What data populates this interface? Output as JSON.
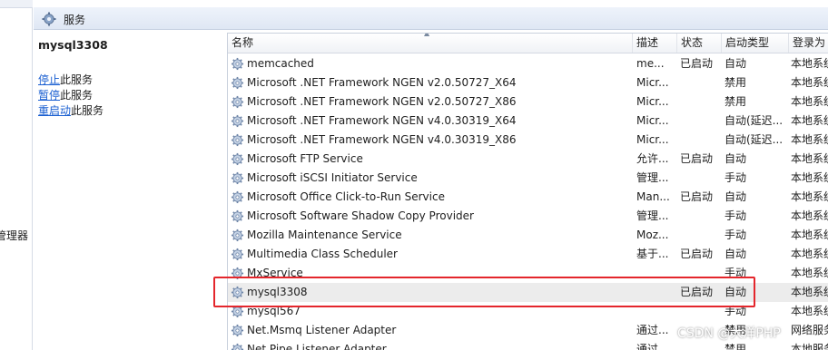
{
  "left_strip": {
    "label": "管理器"
  },
  "header": {
    "title": "服务",
    "icon": "gear-icon"
  },
  "description_pane": {
    "service_name": "mysql3308",
    "actions": [
      {
        "link": "停止",
        "suffix": "此服务"
      },
      {
        "link": "暂停",
        "suffix": "此服务"
      },
      {
        "link": "重启动",
        "suffix": "此服务"
      }
    ]
  },
  "columns": {
    "name": "名称",
    "desc": "描述",
    "status": "状态",
    "startup": "启动类型",
    "logon": "登录为"
  },
  "rows": [
    {
      "name": "memcached",
      "desc": "me...",
      "status": "已启动",
      "startup": "自动",
      "logon": "本地系统"
    },
    {
      "name": "Microsoft .NET Framework NGEN v2.0.50727_X64",
      "desc": "Micr...",
      "status": "",
      "startup": "禁用",
      "logon": "本地系统"
    },
    {
      "name": "Microsoft .NET Framework NGEN v2.0.50727_X86",
      "desc": "Micr...",
      "status": "",
      "startup": "禁用",
      "logon": "本地系统"
    },
    {
      "name": "Microsoft .NET Framework NGEN v4.0.30319_X64",
      "desc": "Micr...",
      "status": "",
      "startup": "自动(延迟...",
      "logon": "本地系统"
    },
    {
      "name": "Microsoft .NET Framework NGEN v4.0.30319_X86",
      "desc": "Micr...",
      "status": "",
      "startup": "自动(延迟...",
      "logon": "本地系统"
    },
    {
      "name": "Microsoft FTP Service",
      "desc": "允许...",
      "status": "已启动",
      "startup": "自动",
      "logon": "本地系统"
    },
    {
      "name": "Microsoft iSCSI Initiator Service",
      "desc": "管理...",
      "status": "",
      "startup": "手动",
      "logon": "本地系统"
    },
    {
      "name": "Microsoft Office Click-to-Run Service",
      "desc": "Man...",
      "status": "已启动",
      "startup": "自动",
      "logon": "本地系统"
    },
    {
      "name": "Microsoft Software Shadow Copy Provider",
      "desc": "管理...",
      "status": "",
      "startup": "手动",
      "logon": "本地系统"
    },
    {
      "name": "Mozilla Maintenance Service",
      "desc": "Moz...",
      "status": "",
      "startup": "手动",
      "logon": "本地系统"
    },
    {
      "name": "Multimedia Class Scheduler",
      "desc": "基于...",
      "status": "已启动",
      "startup": "自动",
      "logon": "本地系统"
    },
    {
      "name": "MxService",
      "desc": "",
      "status": "",
      "startup": "手动",
      "logon": "本地系统"
    },
    {
      "name": "mysql3308",
      "desc": "",
      "status": "已启动",
      "startup": "自动",
      "logon": "本地系统",
      "selected": true
    },
    {
      "name": "mysql567",
      "desc": "",
      "status": "",
      "startup": "手动",
      "logon": "本地系统"
    },
    {
      "name": "Net.Msmq Listener Adapter",
      "desc": "通过...",
      "status": "",
      "startup": "禁用",
      "logon": "网络服务"
    },
    {
      "name": "Net.Pipe Listener Adapter",
      "desc": "通过...",
      "status": "",
      "startup": "禁用",
      "logon": "本地服务"
    }
  ],
  "watermark": "CSDN @大洋PHP",
  "colors": {
    "highlight_box": "#e4262c",
    "link": "#1a5fd1",
    "selected_row": "#ececec"
  }
}
